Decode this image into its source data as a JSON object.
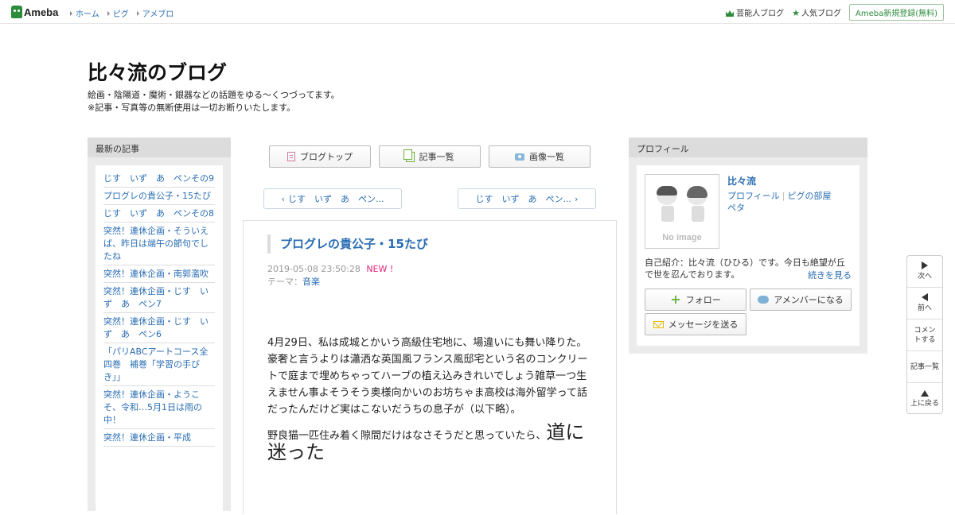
{
  "topbar": {
    "logo": "Ameba",
    "nav": [
      "ホーム",
      "ピグ",
      "アメブロ"
    ],
    "celebrity_blog": "芸能人ブログ",
    "popular_blog": "人気ブログ",
    "register": "Ameba新規登録(無料)"
  },
  "header": {
    "title": "比々流のブログ",
    "desc1": "絵画・陰陽道・魔術・銀器などの話題をゆる～くつづってます。",
    "desc2": "※記事・写真等の無断使用は一切お断りいたします。"
  },
  "left": {
    "heading": "最新の記事",
    "items": [
      "じす　いず　あ　ペンその9",
      "プログレの貴公子・15たび",
      "じす　いず　あ　ペンその8",
      "突然！連休企画・そういえば、昨日は端午の節句でしたね",
      "突然！連休企画・南郭濫吹",
      "突然！連休企画・じす　いず　あ　ペン7",
      "突然！連休企画・じす　いず　あ　ペン6",
      "「パリABCアートコース全四巻　補巻「学習の手びき」」",
      "突然！連休企画・ようこそ、令和…5月1日は雨の中！",
      "突然！連休企画・平成"
    ]
  },
  "toolbar": {
    "blog_top": "ブログトップ",
    "article_list": "記事一覧",
    "image_list": "画像一覧"
  },
  "pager": {
    "prev": "じす　いず　あ　ペン...",
    "next": "じす　いず　あ　ペン..."
  },
  "article": {
    "title": "プログレの貴公子・15たび",
    "datetime": "2019-05-08 23:50:28",
    "new_label": "NEW !",
    "theme_label": "テーマ：",
    "theme": "音楽",
    "p1": "4月29日、私は成城とかいう高級住宅地に、場違いにも舞い降りた。",
    "p2": "豪奢と言うよりは瀟洒な英国風フランス風邸宅という名のコンクリートで庭まで埋めちゃってハーブの植え込みきれいでしょう雑草一つ生えません事よそうそう奥様向かいのお坊ちゃま高校は海外留学って話だったんだけど実はこないだうちの息子が（以下略）。",
    "p3": "野良猫一匹住み着く隙間だけはなさそうだと思っていたら、",
    "p3_big": "道に迷った"
  },
  "profile": {
    "heading": "プロフィール",
    "name": "比々流",
    "profile_link": "プロフィール",
    "pigg_link": "ピグの部屋",
    "peta": "ペタ",
    "noimage": "No image",
    "intro": "自己紹介：比々流（ひひる）です。今日も絶望が丘で世を忍んでおります。",
    "more": "続きを見る",
    "follow": "フォロー",
    "amember": "アメンバーになる",
    "message": "メッセージを送る"
  },
  "floatnav": {
    "next": "次へ",
    "prev": "前へ",
    "comment": "コメントする",
    "articles": "記事一覧",
    "top": "上に戻る"
  },
  "colors": {
    "link": "#2a6db3",
    "brand": "#2d8c3c",
    "new": "#e0257b"
  }
}
